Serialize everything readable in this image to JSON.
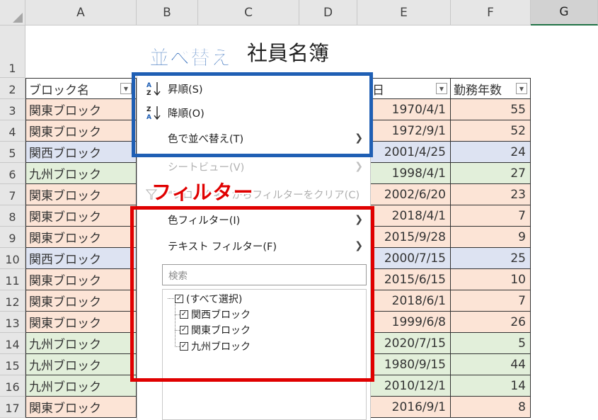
{
  "column_headers": [
    "A",
    "B",
    "C",
    "D",
    "E",
    "F",
    "G"
  ],
  "row_numbers": [
    "1",
    "2",
    "3",
    "4",
    "5",
    "6",
    "7",
    "8",
    "9",
    "10",
    "11",
    "12",
    "13",
    "14",
    "15",
    "16",
    "17"
  ],
  "title": "社員名簿",
  "header_row": {
    "a": "ブロック名",
    "e": "社日",
    "f": "勤務年数"
  },
  "rows": [
    {
      "block": "関東ブロック",
      "date": "1970/4/1",
      "years": "55",
      "color": "#fce4d6"
    },
    {
      "block": "関東ブロック",
      "date": "1972/9/1",
      "years": "52",
      "color": "#fce4d6"
    },
    {
      "block": "関西ブロック",
      "date": "2001/4/25",
      "years": "24",
      "color": "#dde3f2"
    },
    {
      "block": "九州ブロック",
      "date": "1998/4/1",
      "years": "27",
      "color": "#e2efda"
    },
    {
      "block": "関東ブロック",
      "date": "2002/6/20",
      "years": "23",
      "color": "#fce4d6"
    },
    {
      "block": "関東ブロック",
      "date": "2018/4/1",
      "years": "7",
      "color": "#fce4d6"
    },
    {
      "block": "関東ブロック",
      "date": "2015/9/28",
      "years": "9",
      "color": "#fce4d6"
    },
    {
      "block": "関西ブロック",
      "date": "2000/7/15",
      "years": "25",
      "color": "#dde3f2"
    },
    {
      "block": "関東ブロック",
      "date": "2015/6/15",
      "years": "10",
      "color": "#fce4d6"
    },
    {
      "block": "関東ブロック",
      "date": "2018/6/1",
      "years": "7",
      "color": "#fce4d6"
    },
    {
      "block": "関東ブロック",
      "date": "1999/6/8",
      "years": "26",
      "color": "#fce4d6"
    },
    {
      "block": "九州ブロック",
      "date": "2020/7/15",
      "years": "5",
      "color": "#e2efda"
    },
    {
      "block": "九州ブロック",
      "date": "1980/9/15",
      "years": "44",
      "color": "#e2efda"
    },
    {
      "block": "九州ブロック",
      "date": "2010/12/1",
      "years": "14",
      "color": "#e2efda"
    },
    {
      "block": "関東ブロック",
      "date": "2016/9/1",
      "years": "8",
      "color": "#fce4d6"
    }
  ],
  "menu": {
    "sort_asc": "昇順(S)",
    "sort_desc": "降順(O)",
    "sort_by_color": "色で並べ替え(T)",
    "sheet_view": "シートビュー(V)",
    "clear_filter": "\"ブロック名\" からフィルターをクリア(C)",
    "color_filter": "色フィルター(I)",
    "text_filter": "テキスト フィルター(F)",
    "search_placeholder": "検索",
    "filter_items": [
      "(すべて選択)",
      "関西ブロック",
      "関東ブロック",
      "九州ブロック"
    ]
  },
  "annotations": {
    "sort_label": "並べ替え",
    "sort_color": "#1f5fb4",
    "filter_label": "フィルター",
    "filter_color": "#e00000"
  }
}
